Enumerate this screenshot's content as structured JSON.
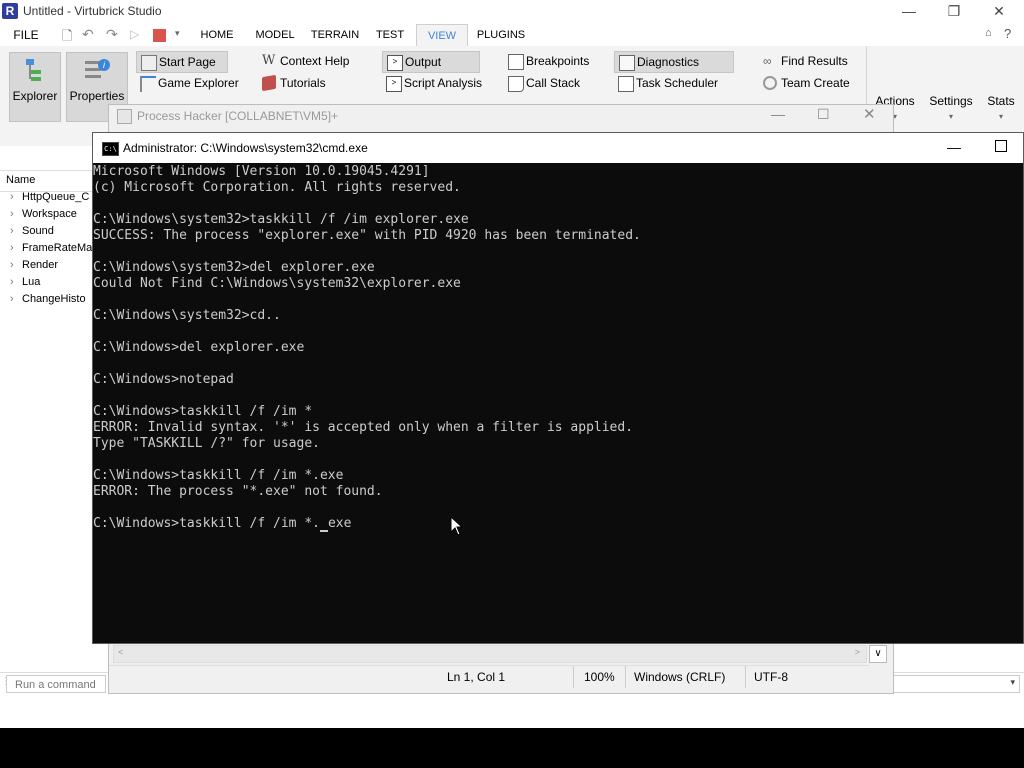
{
  "studio": {
    "title": "Untitled - Virtubrick Studio",
    "logo": "R",
    "caption_buttons": {
      "minimize": "—",
      "restore": "❐",
      "close": "✕"
    },
    "menu": [
      "FILE",
      "HOME",
      "MODEL",
      "TERRAIN",
      "TEST",
      "VIEW",
      "PLUGINS"
    ],
    "active_tab": "VIEW",
    "ribbon": {
      "big_buttons": [
        "Explorer",
        "Properties"
      ],
      "col1": [
        "Start Page",
        "Game Explorer"
      ],
      "col2": [
        "Context Help",
        "Tutorials"
      ],
      "col3": [
        "Output",
        "Script Analysis"
      ],
      "col4": [
        "Breakpoints",
        "Call Stack"
      ],
      "col5": [
        "Diagnostics",
        "Task Scheduler"
      ],
      "col6": [
        "Find Results",
        "Team Create"
      ],
      "groups": [
        "Actions",
        "Settings",
        "Stats"
      ]
    },
    "explorer": {
      "column_header": "Name",
      "items": [
        "HttpQueue_C",
        "Workspace",
        "Sound",
        "FrameRateMa",
        "Render",
        "Lua",
        "ChangeHisto"
      ]
    },
    "command_bar_placeholder": "Run a command"
  },
  "process_hacker": {
    "title": "Process Hacker [COLLABNET\\VM5]+",
    "status": {
      "position": "Ln 1, Col 1",
      "zoom": "100%",
      "line_endings": "Windows (CRLF)",
      "encoding": "UTF-8"
    }
  },
  "cmd": {
    "title": "Administrator: C:\\Windows\\system32\\cmd.exe",
    "icon_text": "C:\\",
    "lines": [
      "Microsoft Windows [Version 10.0.19045.4291]",
      "(c) Microsoft Corporation. All rights reserved.",
      "",
      "C:\\Windows\\system32>taskkill /f /im explorer.exe",
      "SUCCESS: The process \"explorer.exe\" with PID 4920 has been terminated.",
      "",
      "C:\\Windows\\system32>del explorer.exe",
      "Could Not Find C:\\Windows\\system32\\explorer.exe",
      "",
      "C:\\Windows\\system32>cd..",
      "",
      "C:\\Windows>del explorer.exe",
      "",
      "C:\\Windows>notepad",
      "",
      "C:\\Windows>taskkill /f /im *",
      "ERROR: Invalid syntax. '*' is accepted only when a filter is applied.",
      "Type \"TASKKILL /?\" for usage.",
      "",
      "C:\\Windows>taskkill /f /im *.exe",
      "ERROR: The process \"*.exe\" not found.",
      ""
    ],
    "current_prompt": "C:\\Windows>taskkill /f /im *.",
    "current_tail": "exe"
  }
}
